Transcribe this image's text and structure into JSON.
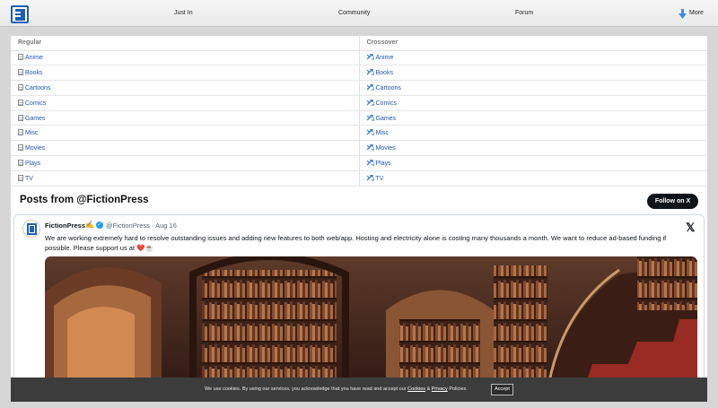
{
  "header": {
    "nav": [
      "Just In",
      "Community",
      "Forum"
    ],
    "more_label": "More"
  },
  "categories": {
    "headers": [
      "Regular",
      "Crossover"
    ],
    "items": [
      "Anime",
      "Books",
      "Cartoons",
      "Comics",
      "Games",
      "Misc",
      "Movies",
      "Plays",
      "TV"
    ]
  },
  "posts": {
    "title": "Posts from @FictionPress",
    "follow_label": "Follow on X",
    "tweet": {
      "name": "FictionPress",
      "emoji": "✍️",
      "handle": "@FictionPress · Aug 16",
      "text": "We are working extremely hard to resolve outstanding issues and adding new features to both web/app. Hosting and electricity alone is costing many thousands a month. We want to reduce ad-based funding if possible. Please support us at",
      "trailing_emoji": "❤️☕"
    }
  },
  "cookie": {
    "text_pre": "We use cookies. By using our services, you acknowledge that you have read and accept our",
    "cookies_link": "Cookies",
    "amp": "&",
    "privacy_link": "Privacy",
    "text_post": "Policies.",
    "accept_label": "Accept"
  },
  "colors": {
    "link": "#1f55b5",
    "brand": "#1e5fb3",
    "follow_button": "#0f1419",
    "cookie_bar": "#3c3c3c"
  }
}
